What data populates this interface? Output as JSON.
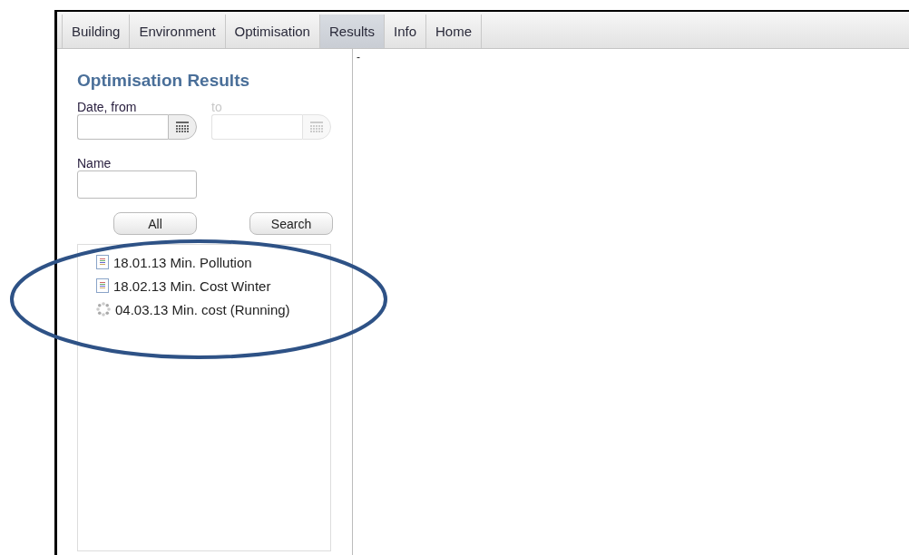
{
  "tabs": [
    {
      "label": "Building",
      "selected": false
    },
    {
      "label": "Environment",
      "selected": false
    },
    {
      "label": "Optimisation",
      "selected": false
    },
    {
      "label": "Results",
      "selected": true
    },
    {
      "label": "Info",
      "selected": false
    },
    {
      "label": "Home",
      "selected": false
    }
  ],
  "panel": {
    "title": "Optimisation Results",
    "date_from": {
      "label": "Date, from",
      "disabled": false
    },
    "date_to": {
      "label": "to",
      "disabled": true
    },
    "name": {
      "label": "Name"
    },
    "buttons": [
      "All",
      "Search"
    ],
    "results": [
      {
        "kind": "document",
        "label": "18.01.13 Min. Pollution"
      },
      {
        "kind": "document",
        "label": "18.02.13 Min. Cost Winter"
      },
      {
        "kind": "running",
        "label": "04.03.13 Min. cost (Running)"
      }
    ]
  },
  "content": {
    "text": "-"
  }
}
